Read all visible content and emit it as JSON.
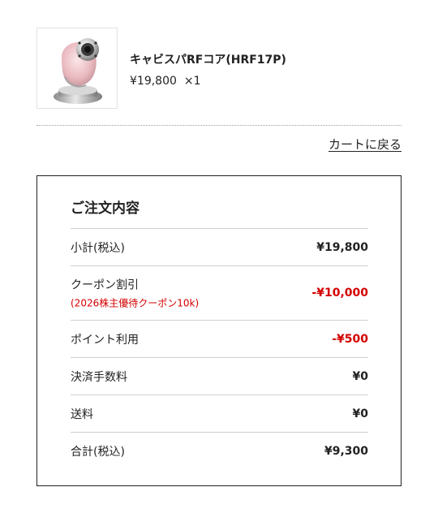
{
  "product": {
    "name": "キャビスパRFコア(HRF17P)",
    "price": "¥19,800",
    "quantity": "×1",
    "image_icon": "facial-device-product-image"
  },
  "navigation": {
    "back_to_cart": "カートに戻る"
  },
  "summary": {
    "title": "ご注文内容",
    "rows": [
      {
        "label": "小計(税込)",
        "value": "¥19,800"
      },
      {
        "label": "クーポン割引",
        "sub": "(2026株主優待クーポン10k)",
        "value": "-¥10,000"
      },
      {
        "label": "ポイント利用",
        "value": "-¥500"
      },
      {
        "label": "決済手数料",
        "value": "¥0"
      },
      {
        "label": "送料",
        "value": "¥0"
      },
      {
        "label": "合計(税込)",
        "value": "¥9,300"
      }
    ]
  },
  "colors": {
    "discount": "#d40000",
    "border": "#222222",
    "row_divider": "#cfcfcf"
  }
}
